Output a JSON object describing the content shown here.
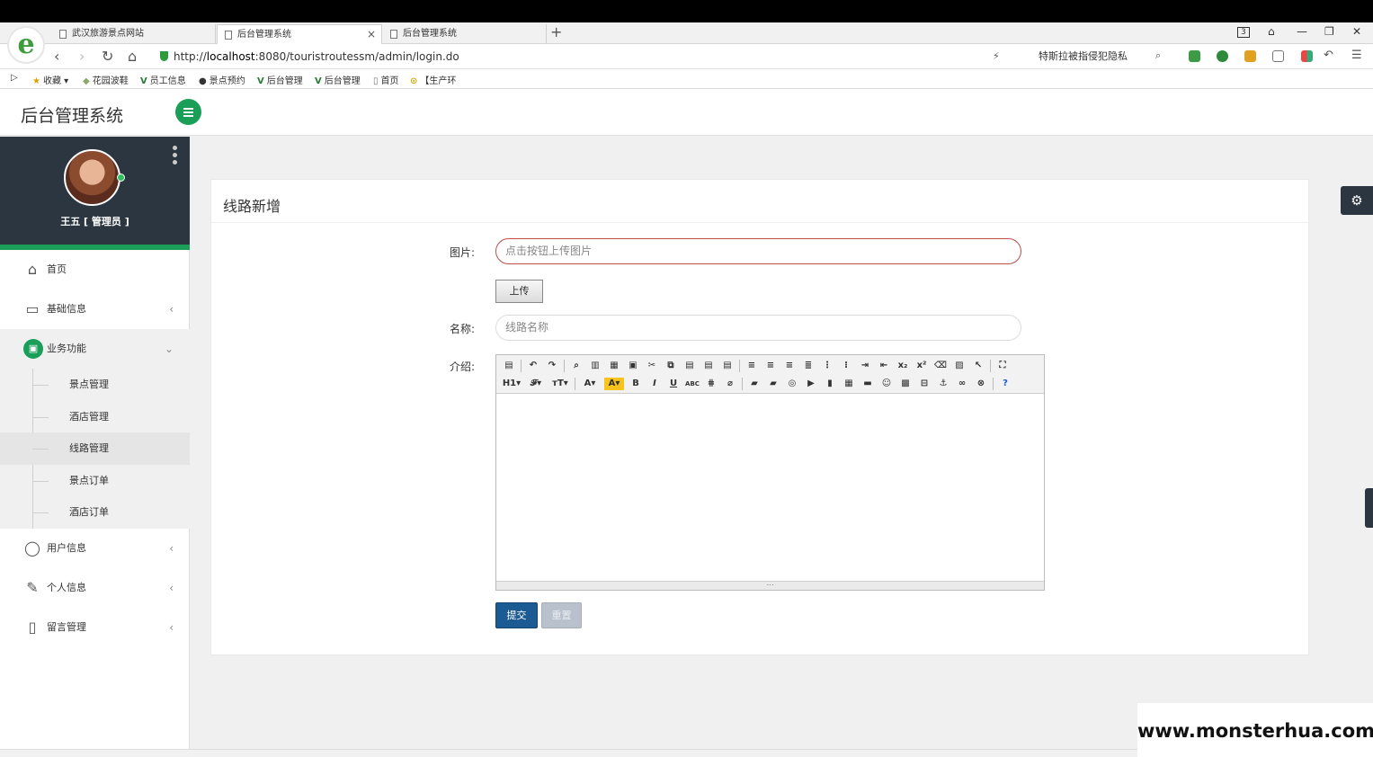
{
  "browser": {
    "tabs": [
      "武汉旅游景点网站",
      "后台管理系统",
      "后台管理系统"
    ],
    "tab_close": "×",
    "new_tab": "+",
    "url_prefix": "http://",
    "url_host": "localhost",
    "url_path": ":8080/touristroutessm/admin/login.do",
    "search_text": "特斯拉被指侵犯隐私",
    "window_badge": "3",
    "bookmarks": [
      "收藏",
      "花园波鞋",
      "员工信息",
      "景点预约",
      "后台管理",
      "后台管理",
      "首页",
      "【生产环"
    ]
  },
  "header": {
    "brand": "后台管理系统"
  },
  "sidebar": {
    "username": "王五 [ 管理员 ]",
    "items": [
      {
        "label": "首页",
        "icon": "home-icon"
      },
      {
        "label": "基础信息",
        "icon": "briefcase-icon"
      },
      {
        "label": "业务功能",
        "icon": "monitor-icon"
      },
      {
        "label": "用户信息",
        "icon": "user-icon"
      },
      {
        "label": "个人信息",
        "icon": "edit-icon"
      },
      {
        "label": "留言管理",
        "icon": "bookmark-icon"
      }
    ],
    "sub_items": [
      "景点管理",
      "酒店管理",
      "线路管理",
      "景点订单",
      "酒店订单"
    ]
  },
  "form": {
    "title": "线路新增",
    "image_label": "图片:",
    "image_placeholder": "点击按钮上传图片",
    "upload_label": "上传",
    "name_label": "名称:",
    "name_placeholder": "线路名称",
    "intro_label": "介绍:",
    "submit_label": "提交",
    "reset_label": "重置"
  },
  "watermark": "www.monsterhua.com",
  "colors": {
    "accent": "#1a9e58",
    "sidebar_dark": "#2b3641",
    "primary_button": "#1c5a94",
    "error_border": "#c0504d"
  }
}
